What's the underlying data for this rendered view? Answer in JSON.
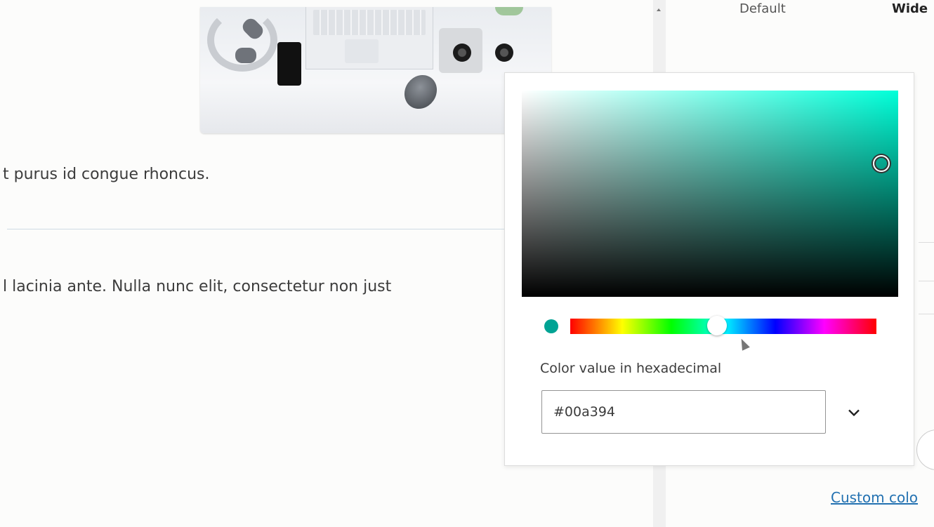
{
  "editor": {
    "paragraph_1": "t purus id congue rhoncus.",
    "paragraph_2": "l lacinia ante. Nulla nunc elit, consectetur non just"
  },
  "sidebar": {
    "option_default": "Default",
    "option_wide": "Wide",
    "custom_color_link": "Custom colo"
  },
  "color_picker": {
    "hex_label": "Color value in hexadecimal",
    "hex_value": "#00a394",
    "selected_color": "#00a394",
    "base_hue_color": "#00ffd9",
    "hue_fraction": 0.48
  }
}
